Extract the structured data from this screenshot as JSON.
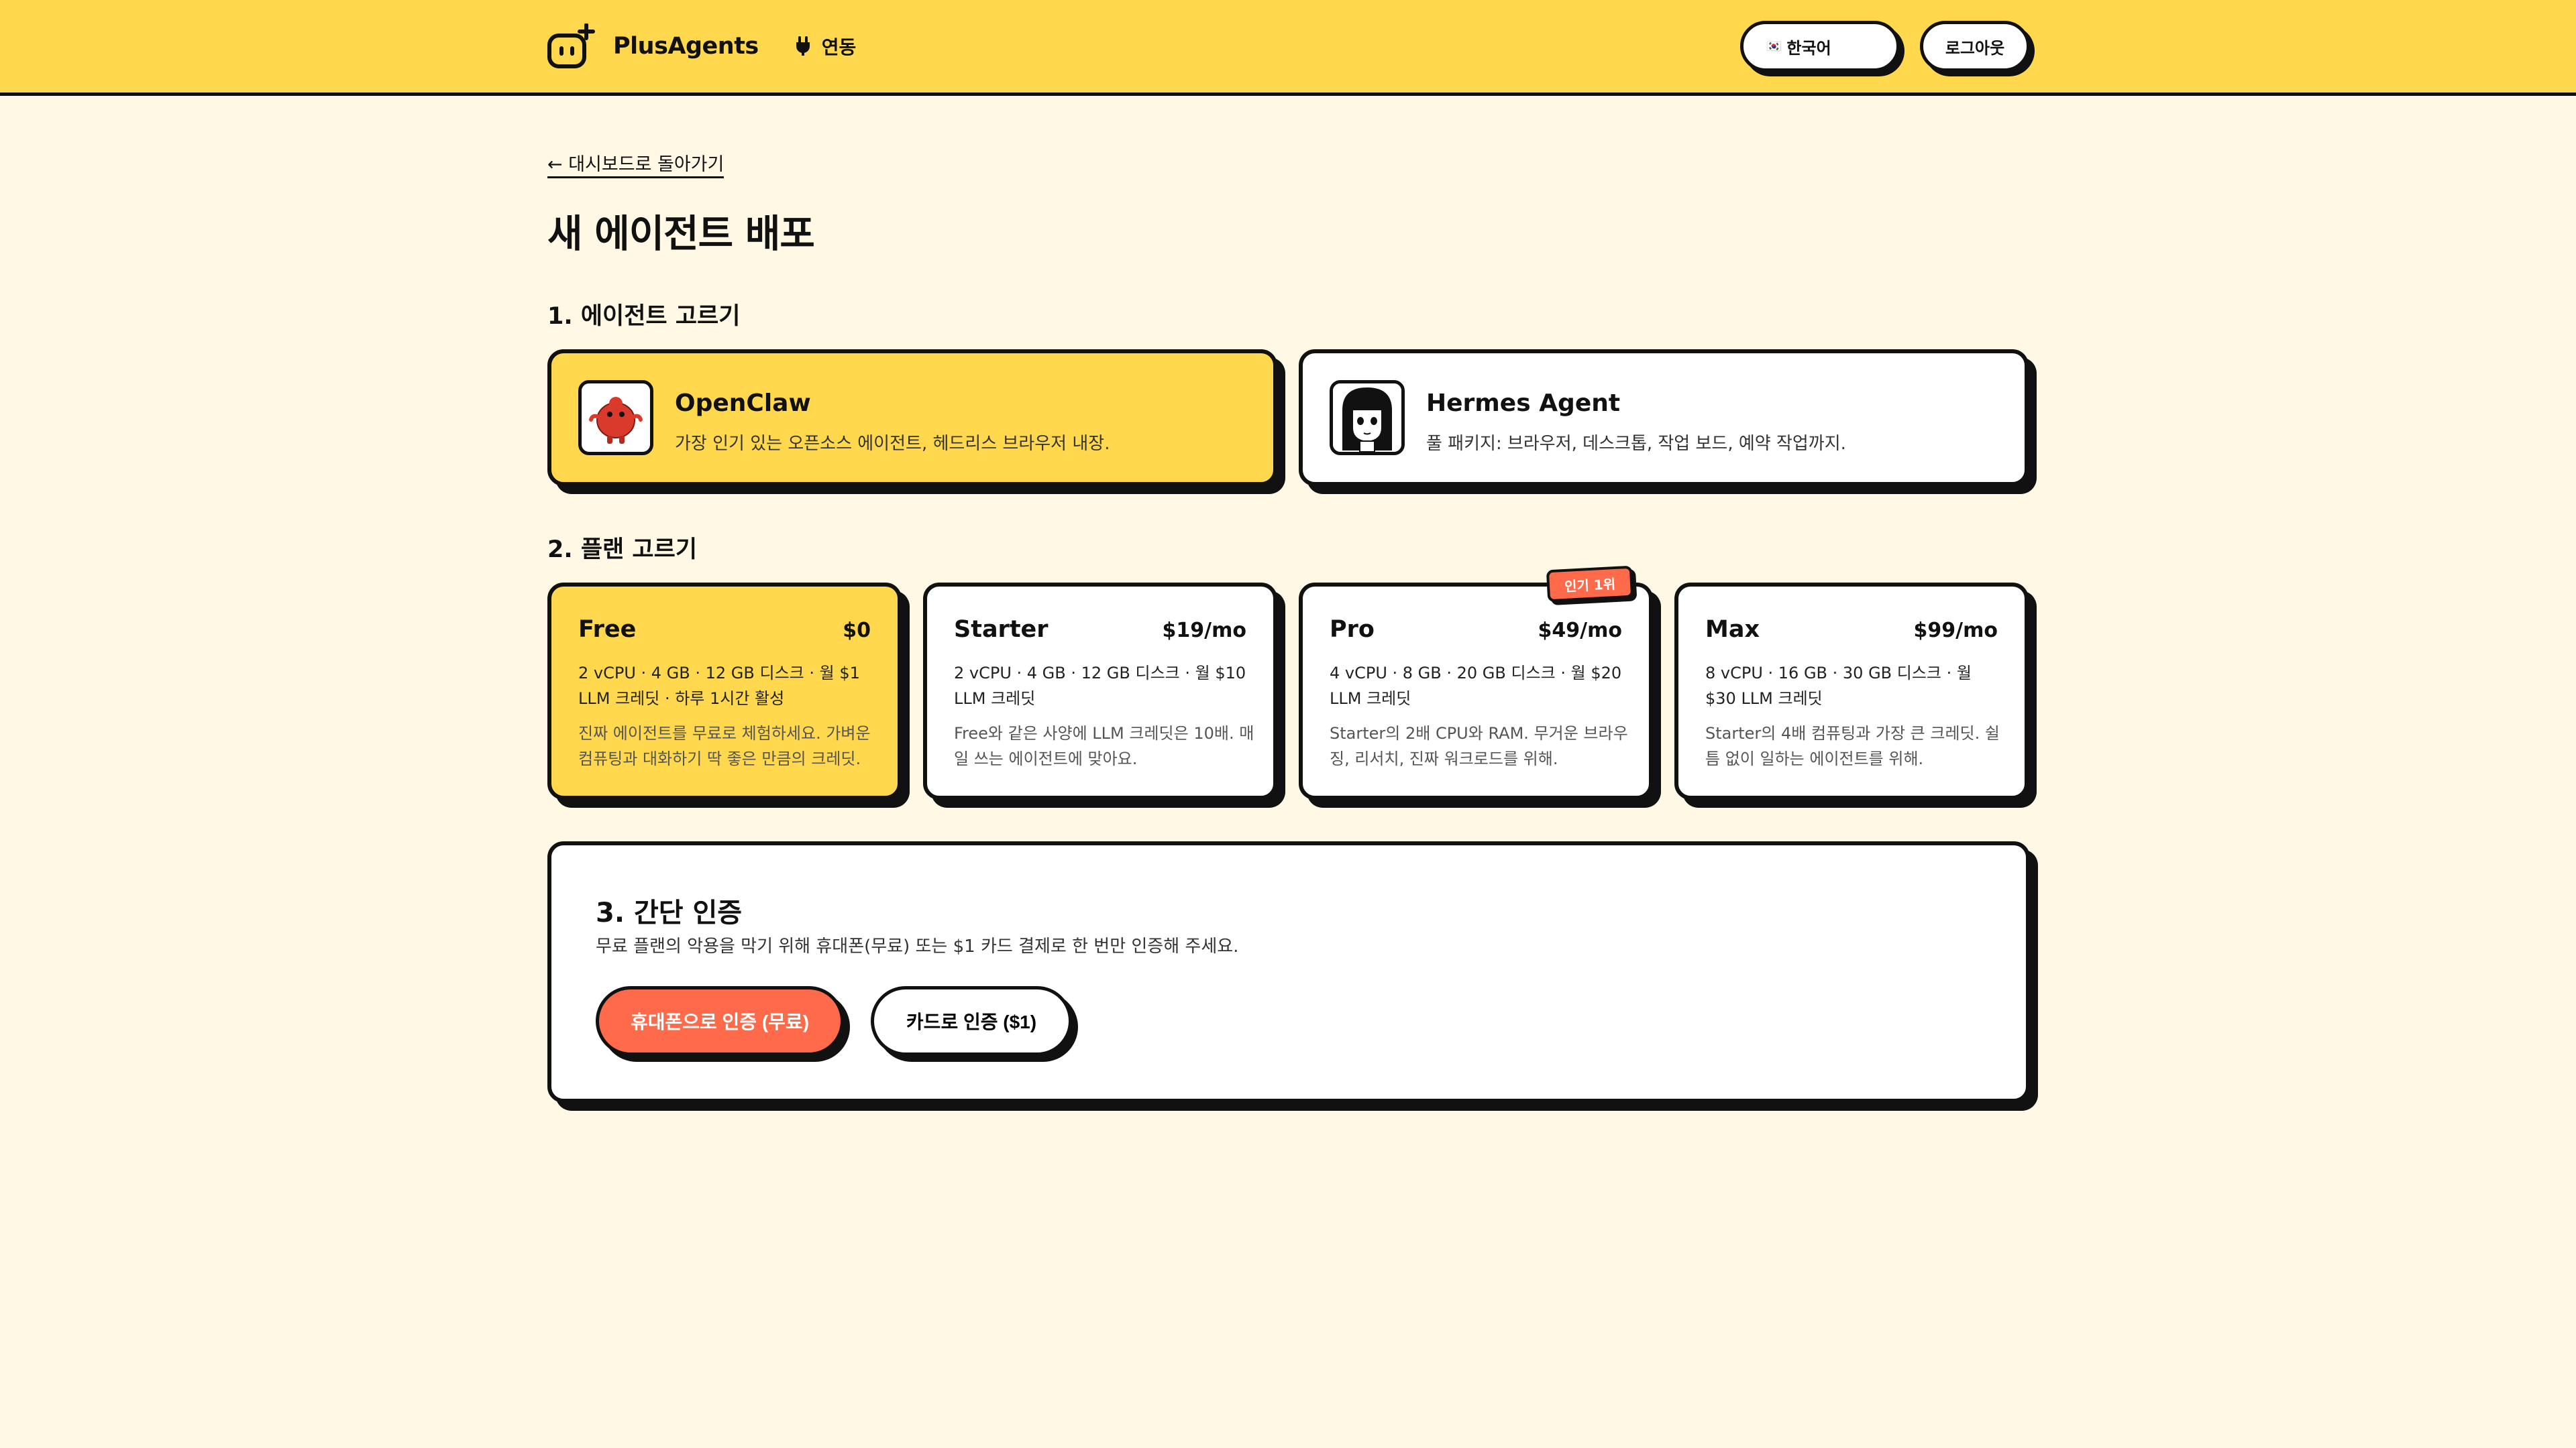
{
  "header": {
    "brand": "PlusAgents",
    "nav_integrations": "연동",
    "language": "한국어",
    "language_flag": "🇰🇷",
    "logout": "로그아웃"
  },
  "page": {
    "back_link": "← 대시보드로 돌아가기",
    "title": "새 에이전트 배포"
  },
  "step1": {
    "heading": "1. 에이전트 고르기",
    "agents": [
      {
        "name": "OpenClaw",
        "description": "가장 인기 있는 오픈소스 에이전트, 헤드리스 브라우저 내장.",
        "selected": true
      },
      {
        "name": "Hermes Agent",
        "description": "풀 패키지: 브라우저, 데스크톱, 작업 보드, 예약 작업까지.",
        "selected": false
      }
    ]
  },
  "step2": {
    "heading": "2. 플랜 고르기",
    "popular_badge": "인기 1위",
    "plans": [
      {
        "name": "Free",
        "price": "$0",
        "specs": "2 vCPU · 4 GB · 12 GB 디스크 · 월 $1 LLM 크레딧 · 하루 1시간 활성",
        "blurb": "진짜 에이전트를 무료로 체험하세요. 가벼운 컴퓨팅과 대화하기 딱 좋은 만큼의 크레딧.",
        "selected": true
      },
      {
        "name": "Starter",
        "price": "$19/mo",
        "specs": "2 vCPU · 4 GB · 12 GB 디스크 · 월 $10 LLM 크레딧",
        "blurb": "Free와 같은 사양에 LLM 크레딧은 10배. 매일 쓰는 에이전트에 맞아요.",
        "selected": false
      },
      {
        "name": "Pro",
        "price": "$49/mo",
        "specs": "4 vCPU · 8 GB · 20 GB 디스크 · 월 $20 LLM 크레딧",
        "blurb": "Starter의 2배 CPU와 RAM. 무거운 브라우징, 리서치, 진짜 워크로드를 위해.",
        "selected": false
      },
      {
        "name": "Max",
        "price": "$99/mo",
        "specs": "8 vCPU · 16 GB · 30 GB 디스크 · 월 $30 LLM 크레딧",
        "blurb": "Starter의 4배 컴퓨팅과 가장 큰 크레딧. 쉴 틈 없이 일하는 에이전트를 위해.",
        "selected": false
      }
    ]
  },
  "step3": {
    "heading": "3. 간단 인증",
    "description": "무료 플랜의 악용을 막기 위해 휴대폰(무료) 또는 $1 카드 결제로 한 번만 인증해 주세요.",
    "phone_button": "휴대폰으로 인증 (무료)",
    "card_button": "카드로 인증 ($1)"
  },
  "colors": {
    "accent_yellow": "#FFD84D",
    "accent_orange": "#FF6B4A",
    "background": "#FFF8E5",
    "ink": "#111111"
  },
  "icons": {
    "logo": "robot-plus-icon",
    "nav": "plug-icon",
    "openclaw_avatar": "red-creature-icon",
    "hermes_avatar": "anime-girl-portrait-icon"
  }
}
